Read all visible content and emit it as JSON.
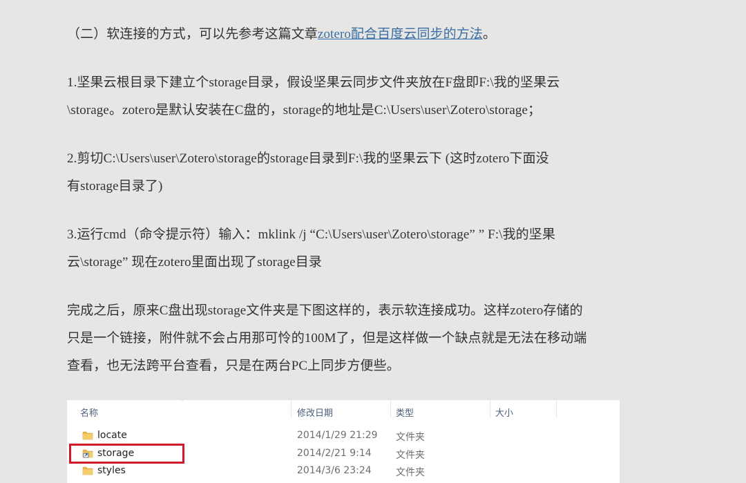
{
  "intro": {
    "prefix": "（二）软连接的方式，可以先参考这篇文章",
    "link_text": "zotero配合百度云同步的方法",
    "suffix": "。"
  },
  "steps": [
    {
      "line1": "1.坚果云根目录下建立个storage目录，假设坚果云同步文件夹放在F盘即F:\\我的坚果云",
      "line2": "\\storage。zotero是默认安装在C盘的，storage的地址是C:\\Users\\user\\Zotero\\storage；"
    },
    {
      "line1": "2.剪切C:\\Users\\user\\Zotero\\storage的storage目录到F:\\我的坚果云下 (这时zotero下面没",
      "line2": "有storage目录了)"
    },
    {
      "line1": "3.运行cmd（命令提示符）输入：mklink /j “C:\\Users\\user\\Zotero\\storage” ” F:\\我的坚果",
      "line2": "云\\storage” 现在zotero里面出现了storage目录"
    }
  ],
  "conclusion": {
    "line1": "完成之后，原来C盘出现storage文件夹是下图这样的，表示软连接成功。这样zotero存储的",
    "line2": "只是一个链接，附件就不会占用那可怜的100M了，但是这样做一个缺点就是无法在移动端",
    "line3": "查看，也无法跨平台查看，只是在两台PC上同步方便些。"
  },
  "explorer": {
    "columns": {
      "name": "名称",
      "modified": "修改日期",
      "type": "类型",
      "size": "大小"
    },
    "rows": [
      {
        "name": "locate",
        "modified": "2014/1/29 21:29",
        "type": "文件夹",
        "icon": "folder-icon"
      },
      {
        "name": "storage",
        "modified": "2014/2/21 9:14",
        "type": "文件夹",
        "icon": "folder-shortcut-icon"
      },
      {
        "name": "styles",
        "modified": "2014/3/6 23:24",
        "type": "文件夹",
        "icon": "folder-icon"
      }
    ],
    "highlight_color": "#d0192a",
    "folder_color": "#e8b84a"
  }
}
